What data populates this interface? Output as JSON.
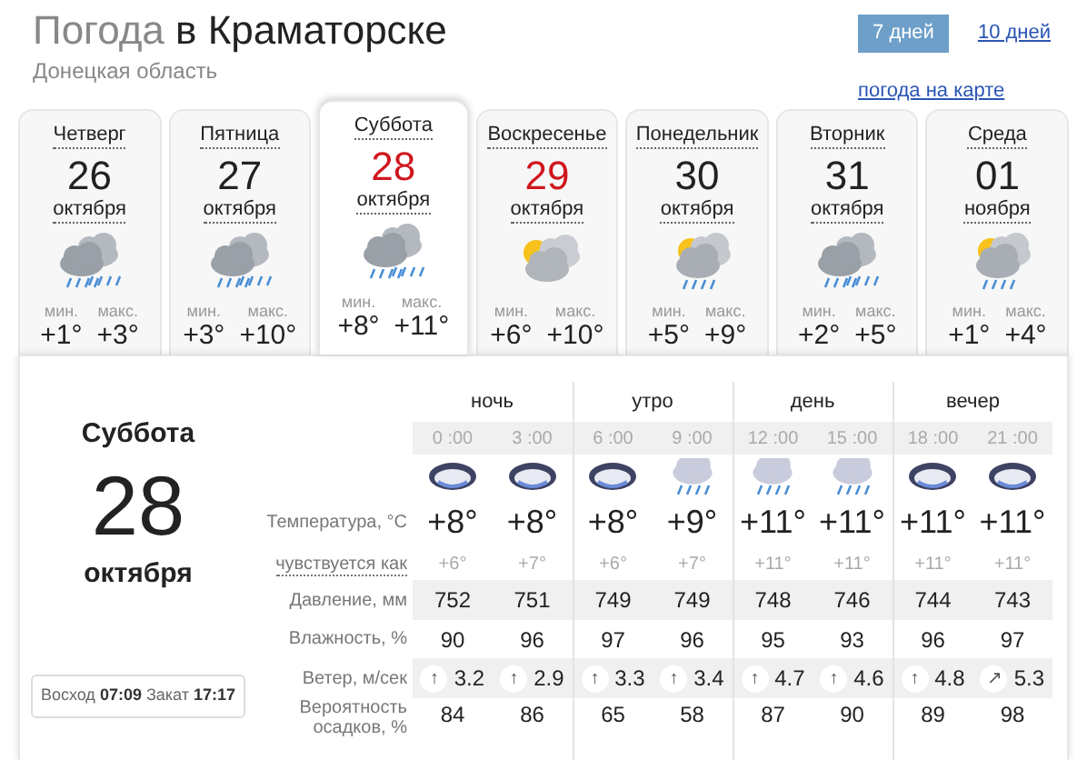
{
  "header": {
    "title_lead": "Погода",
    "title_city": "в Краматорске",
    "region": "Донецкая область"
  },
  "range_tabs": [
    {
      "label": "7 дней",
      "selected": true
    },
    {
      "label": "10 дней",
      "selected": false
    }
  ],
  "map_link": "погода на карте",
  "days": [
    {
      "weekday": "Четверг",
      "date": "26",
      "month": "октября",
      "kind": "rain",
      "weekend": false,
      "selected": false,
      "min_label": "мин.",
      "min": "+1°",
      "max_label": "макс.",
      "max": "+3°"
    },
    {
      "weekday": "Пятница",
      "date": "27",
      "month": "октября",
      "kind": "rain",
      "weekend": false,
      "selected": false,
      "min_label": "мин.",
      "min": "+3°",
      "max_label": "макс.",
      "max": "+10°"
    },
    {
      "weekday": "Суббота",
      "date": "28",
      "month": "октября",
      "kind": "rain",
      "weekend": true,
      "selected": true,
      "min_label": "мин.",
      "min": "+8°",
      "max_label": "макс.",
      "max": "+11°"
    },
    {
      "weekday": "Воскресенье",
      "date": "29",
      "month": "октября",
      "kind": "sun-cloud",
      "weekend": true,
      "selected": false,
      "min_label": "мин.",
      "min": "+6°",
      "max_label": "макс.",
      "max": "+10°"
    },
    {
      "weekday": "Понедельник",
      "date": "30",
      "month": "октября",
      "kind": "sun-rain",
      "weekend": false,
      "selected": false,
      "min_label": "мин.",
      "min": "+5°",
      "max_label": "макс.",
      "max": "+9°"
    },
    {
      "weekday": "Вторник",
      "date": "31",
      "month": "октября",
      "kind": "rain",
      "weekend": false,
      "selected": false,
      "min_label": "мин.",
      "min": "+2°",
      "max_label": "макс.",
      "max": "+5°"
    },
    {
      "weekday": "Среда",
      "date": "01",
      "month": "ноября",
      "kind": "sun-rain",
      "weekend": false,
      "selected": false,
      "min_label": "мин.",
      "min": "+1°",
      "max_label": "макс.",
      "max": "+4°"
    }
  ],
  "detail": {
    "weekday": "Суббота",
    "date": "28",
    "month": "октября",
    "sun": {
      "rise_label": "Восход",
      "rise": "07:09",
      "set_label": "Закат",
      "set": "17:17"
    },
    "row_labels": [
      {
        "text": "Температура, °C",
        "kind": "plain"
      },
      {
        "text": "чувствуется как",
        "kind": "hint"
      },
      {
        "text": "Давление, мм",
        "kind": "plain"
      },
      {
        "text": "Влажность, %",
        "kind": "plain"
      },
      {
        "text": "Ветер, м/сек",
        "kind": "plain"
      },
      {
        "text": "Вероятность осадков, %",
        "kind": "plain"
      }
    ],
    "periods": [
      {
        "label": "ночь",
        "hours": [
          {
            "time": "0 :00",
            "kind": "dark-rain",
            "temp": "+8°",
            "feels": "+6°",
            "pressure": "752",
            "humidity": "90",
            "wind_arrow": "↑",
            "wind": "3.2",
            "precip": "84"
          },
          {
            "time": "3 :00",
            "kind": "dark-rain",
            "temp": "+8°",
            "feels": "+7°",
            "pressure": "751",
            "humidity": "96",
            "wind_arrow": "↑",
            "wind": "2.9",
            "precip": "86"
          }
        ]
      },
      {
        "label": "утро",
        "hours": [
          {
            "time": "6 :00",
            "kind": "dark-rain",
            "temp": "+8°",
            "feels": "+6°",
            "pressure": "749",
            "humidity": "97",
            "wind_arrow": "↑",
            "wind": "3.3",
            "precip": "65"
          },
          {
            "time": "9 :00",
            "kind": "light-rain",
            "temp": "+9°",
            "feels": "+7°",
            "pressure": "749",
            "humidity": "96",
            "wind_arrow": "↑",
            "wind": "3.4",
            "precip": "58"
          }
        ]
      },
      {
        "label": "день",
        "hours": [
          {
            "time": "12 :00",
            "kind": "light-rain",
            "temp": "+11°",
            "feels": "+11°",
            "pressure": "748",
            "humidity": "95",
            "wind_arrow": "↑",
            "wind": "4.7",
            "precip": "87"
          },
          {
            "time": "15 :00",
            "kind": "light-rain",
            "temp": "+11°",
            "feels": "+11°",
            "pressure": "746",
            "humidity": "93",
            "wind_arrow": "↑",
            "wind": "4.6",
            "precip": "90"
          }
        ]
      },
      {
        "label": "вечер",
        "hours": [
          {
            "time": "18 :00",
            "kind": "dark-rain",
            "temp": "+11°",
            "feels": "+11°",
            "pressure": "744",
            "humidity": "96",
            "wind_arrow": "↑",
            "wind": "4.8",
            "precip": "89"
          },
          {
            "time": "21 :00",
            "kind": "dark-rain",
            "temp": "+11°",
            "feels": "+11°",
            "pressure": "743",
            "humidity": "97",
            "wind_arrow": "↗",
            "wind": "5.3",
            "precip": "98"
          }
        ]
      }
    ]
  }
}
